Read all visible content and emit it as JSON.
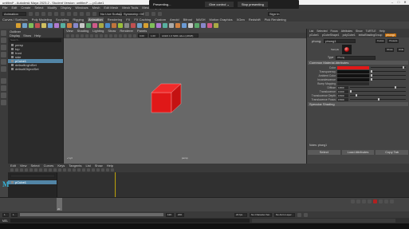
{
  "window": {
    "title": "untitled* - Autodesk Maya 2023.2 - Student Version: untitled* --- pCube1",
    "controls": [
      "–",
      "□",
      "✕"
    ]
  },
  "menubar": [
    "File",
    "Edit",
    "Create",
    "Select",
    "Modify",
    "Display",
    "Windows",
    "Mesh",
    "Edit Mesh",
    "Mesh Tools",
    "Mesh Display",
    "Curves",
    "Surfaces",
    "Deform",
    "UV",
    "Generate",
    "Cache",
    "Arnold",
    "Help"
  ],
  "statusline": {
    "mode": "Animation",
    "no_live_surface": "No Live Surface",
    "symmetry": "Symmetry: Off",
    "sign_in": "Sign In"
  },
  "shelf": {
    "tabs": [
      "Curves / Surfaces",
      "Poly Modeling",
      "Sculpting",
      "Rigging",
      "Animation",
      "Rendering",
      "FX",
      "FX Caching",
      "Custom",
      "Arnold",
      "Bifrost",
      "MASH",
      "Motion Graphics",
      "XGen",
      "Redshift",
      "Pick Rendering"
    ],
    "active_tab": "Animation",
    "icon_colors": [
      "#d8a030",
      "#6fa0c8",
      "#7fbf5a",
      "#c05050",
      "#d0c060",
      "#6a9ad4",
      "#b07ad0",
      "#58b0a0",
      "#d08040",
      "#8888cc",
      "#c8c8c8",
      "#5aa86a",
      "#d05a8a",
      "#aaaa44",
      "#4a8acb",
      "#c0743c",
      "#9abf3a",
      "#888888",
      "#c05050",
      "#6fa0c8",
      "#d8a030",
      "#7fbf5a",
      "#b07ad0",
      "#58b0a0",
      "#aaaaaa",
      "#d08040",
      "#6a9ad4",
      "#c8c8c8",
      "#5aa86a",
      "#8888cc",
      "#d05a8a",
      "#aaaa44"
    ]
  },
  "outliner": {
    "title": "Outliner",
    "menu": [
      "Display",
      "Show",
      "Help"
    ],
    "search_placeholder": "Search...",
    "items": [
      {
        "label": "persp",
        "selected": false
      },
      {
        "label": "top",
        "selected": false
      },
      {
        "label": "front",
        "selected": false
      },
      {
        "label": "side",
        "selected": false
      },
      {
        "label": "pCube1",
        "selected": true
      },
      {
        "label": "defaultLightSet",
        "selected": false
      },
      {
        "label": "defaultObjectSet",
        "selected": false
      }
    ]
  },
  "viewport": {
    "menu": [
      "View",
      "Shading",
      "Lighting",
      "Show",
      "Renderer",
      "Panels"
    ],
    "camera_label": "persp",
    "color_space": "ACES 1.0 SDR-video (sRGB)",
    "exposure": "0.00",
    "gamma": "1.00",
    "cube_color": "#e01818"
  },
  "attribute_editor": {
    "menu": [
      "List",
      "Selected",
      "Focus",
      "Attributes",
      "Show",
      "TURTLE",
      "Help"
    ],
    "tabs": [
      "pCube1",
      "pCubeShape1",
      "polyCube1",
      "initialShadingGroup",
      "phong1"
    ],
    "active_tab": "phong1",
    "node_label": "phong:",
    "node_value": "phong1",
    "focus_button": "Focus",
    "presets_button": "Presets",
    "show_button": "Show",
    "hide_button": "Hide",
    "sample_label": "Sample",
    "type_label": "Type",
    "type_value": "Phong",
    "section_common": "Common Material Attributes",
    "attributes": [
      {
        "label": "Color",
        "kind": "swatch",
        "color": "#e01818"
      },
      {
        "label": "Transparency",
        "kind": "swatch",
        "color": "#111111"
      },
      {
        "label": "Ambient Color",
        "kind": "swatch",
        "color": "#111111"
      },
      {
        "label": "Incandescence",
        "kind": "swatch",
        "color": "#111111"
      },
      {
        "label": "Bump Mapping",
        "kind": "empty"
      },
      {
        "label": "Diffuse",
        "kind": "slider",
        "value": "0.800",
        "level": 0.8
      },
      {
        "label": "Translucence",
        "kind": "slider",
        "value": "0.000",
        "level": 0.0
      },
      {
        "label": "Translucence Depth",
        "kind": "slider",
        "value": "0.500",
        "level": 0.1
      },
      {
        "label": "Translucence Focus",
        "kind": "slider",
        "value": "0.500",
        "level": 0.5
      }
    ],
    "section_specular": "Specular Shading",
    "notes_label": "Notes: phong1",
    "buttons": [
      "Select",
      "Load Attributes",
      "Copy Tab"
    ]
  },
  "graph_editor": {
    "menu": [
      "Edit",
      "View",
      "Select",
      "Curves",
      "Keys",
      "Tangents",
      "List",
      "Show",
      "Help"
    ],
    "list_item": "pCube1",
    "y_ticks": [
      "0.8",
      "0.6",
      "0.4",
      "0.2",
      "0"
    ],
    "x_ticks": [
      "1",
      "10",
      "20",
      "30",
      "40",
      "50",
      "60",
      "70",
      "80",
      "90",
      "100",
      "110",
      "120"
    ]
  },
  "time": {
    "start": "1",
    "end": "120",
    "playback_end": "120",
    "max_end": "200",
    "current_frame": "20",
    "fps": "24 fps",
    "no_character_set": "No Character Set",
    "no_anim_layer": "No Anim Layer",
    "ticks": [
      "5",
      "10",
      "15",
      "20",
      "25",
      "30",
      "35",
      "40",
      "45",
      "50",
      "55",
      "60",
      "65",
      "70",
      "75",
      "80",
      "85",
      "90",
      "95",
      "100",
      "105",
      "110",
      "115",
      "120"
    ]
  },
  "command_line": {
    "language": "MEL"
  },
  "presenting_bar": {
    "label": "Presenting...",
    "control": "Give control",
    "stop": "Stop presenting"
  }
}
